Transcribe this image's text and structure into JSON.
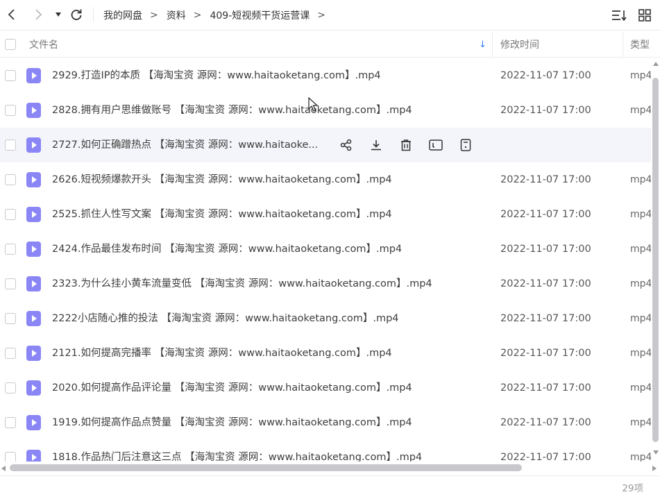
{
  "breadcrumb": [
    "我的网盘",
    "资料",
    "409-短视频干货运营课"
  ],
  "breadcrumb_separator": ">",
  "toolbar": {
    "back_icon": "chevron-left-icon",
    "forward_icon": "chevron-right-icon",
    "history_icon": "caret-down-icon",
    "refresh_icon": "refresh-icon",
    "sort_icon": "sort-icon",
    "view_icon": "grid-view-icon"
  },
  "columns": {
    "name": "文件名",
    "modified": "修改时间",
    "type": "类型",
    "sort_indicator": "↓"
  },
  "files": [
    {
      "name": "2929.打造IP的本质 【海淘宝资 源网：www.haitaoketang.com】.mp4",
      "modified": "2022-11-07 17:00",
      "type": "mp4"
    },
    {
      "name": "2828.拥有用户思维做账号 【海淘宝资 源网：www.haitaoketang.com】.mp4",
      "modified": "2022-11-07 17:00",
      "type": "mp4"
    },
    {
      "name": "2727.如何正确蹭热点 【海淘宝资 源网：www.haitaoke...",
      "modified": "",
      "type": "",
      "hovered": true
    },
    {
      "name": "2626.短视频爆款开头 【海淘宝资 源网：www.haitaoketang.com】.mp4",
      "modified": "2022-11-07 17:00",
      "type": "mp4"
    },
    {
      "name": "2525.抓住人性写文案 【海淘宝资 源网：www.haitaoketang.com】.mp4",
      "modified": "2022-11-07 17:00",
      "type": "mp4"
    },
    {
      "name": "2424.作品最佳发布时间 【海淘宝资 源网：www.haitaoketang.com】.mp4",
      "modified": "2022-11-07 17:00",
      "type": "mp4"
    },
    {
      "name": "2323.为什么挂小黄车流量变低 【海淘宝资 源网：www.haitaoketang.com】.mp4",
      "modified": "2022-11-07 17:00",
      "type": "mp4"
    },
    {
      "name": "2222小店随心推的投法 【海淘宝资 源网：www.haitaoketang.com】.mp4",
      "modified": "2022-11-07 17:00",
      "type": "mp4"
    },
    {
      "name": "2121.如何提高完播率 【海淘宝资 源网：www.haitaoketang.com】.mp4",
      "modified": "2022-11-07 17:00",
      "type": "mp4"
    },
    {
      "name": "2020.如何提高作品评论量 【海淘宝资 源网：www.haitaoketang.com】.mp4",
      "modified": "2022-11-07 17:00",
      "type": "mp4"
    },
    {
      "name": "1919.如何提高作品点赞量 【海淘宝资 源网：www.haitaoketang.com】.mp4",
      "modified": "2022-11-07 17:00",
      "type": "mp4"
    },
    {
      "name": "1818.作品热门后注意这三点 【海淘宝资 源网：www.haitaoketang.com】.mp4",
      "modified": "2022-11-07 17:00",
      "type": "mp4"
    }
  ],
  "row_actions": [
    "share-icon",
    "download-icon",
    "delete-icon",
    "rename-icon",
    "more-icon"
  ],
  "item_count": "29项",
  "colors": {
    "accent": "#2f7cf6",
    "video_icon": "#8a86f5",
    "hover_row": "#f4f5fa",
    "border": "#ececf0"
  }
}
